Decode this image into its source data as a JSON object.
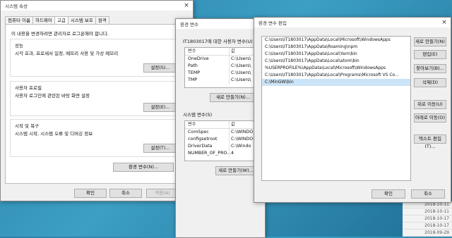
{
  "system_properties": {
    "title": "시스템 속성",
    "close_icon": "×",
    "tabs": [
      "컴퓨터 이름",
      "하드웨어",
      "고급",
      "시스템 보호",
      "원격"
    ],
    "admin_note": "이 내용을 변경하려면 관리자로 로그온해야 합니다.",
    "groups": [
      {
        "title": "성능",
        "desc": "시각 효과, 프로세서 일정, 메모리 사용 및 가상 메모리",
        "button": "설정(S)..."
      },
      {
        "title": "사용자 프로필",
        "desc": "사용자 로그인에 관련된 바탕 화면 설정",
        "button": "설정(E)..."
      },
      {
        "title": "시작 및 복구",
        "desc": "시스템 시작, 시스템 오류 및 디버깅 정보",
        "button": "설정(T)..."
      }
    ],
    "env_button": "환경 변수(N)...",
    "ok": "확인",
    "cancel": "취소",
    "apply": "적용(A)"
  },
  "env_vars": {
    "title": "환경 변수",
    "user_section": "IT1803017에 대한 사용자 변수(U)",
    "col_var": "변수",
    "col_val": "값",
    "user_vars": [
      {
        "name": "OneDrive",
        "value": "C:\\Users\\"
      },
      {
        "name": "Path",
        "value": "C:\\Users\\"
      },
      {
        "name": "TEMP",
        "value": "C:\\Users\\"
      },
      {
        "name": "TMP",
        "value": "C:\\Users\\"
      }
    ],
    "user_new": "새로 만들기(N)...",
    "system_section": "시스템 변수(S)",
    "system_vars": [
      {
        "name": "ComSpec",
        "value": "C:\\WINDO"
      },
      {
        "name": "configsetroot",
        "value": "C:\\WINDO"
      },
      {
        "name": "DriverData",
        "value": "C:\\Windo"
      },
      {
        "name": "NUMBER_OF_PRO...",
        "value": "4"
      }
    ],
    "system_new": "새로 만들기(W)..."
  },
  "edit_env": {
    "title": "환경 변수 편집",
    "close_icon": "×",
    "paths": [
      "C:\\Users\\IT1803017\\AppData\\Local\\Microsoft\\WindowsApps",
      "C:\\Users\\IT1803017\\AppData\\Roaming\\npm",
      "C:\\Users\\IT1803017\\AppData\\Local\\Yarn\\bin",
      "C:\\Users\\IT1803017\\AppData\\Local\\atom\\bin",
      "%USERPROFILE%\\AppData\\Local\\Microsoft\\WindowsApps",
      "C:\\Users\\IT1803017\\AppData\\Local\\Programs\\Microsoft VS Co...",
      "C:\\MinGW\\bin"
    ],
    "buttons": [
      "새로 만들기(N)",
      "편집(E)",
      "찾아보기(B)...",
      "삭제(D)",
      "위로 이동(U)",
      "아래로 이동(O)",
      "텍스트 편집(T)..."
    ],
    "ok": "확인",
    "cancel": "취소"
  },
  "background_dates": [
    "2018-10-11",
    "2018-10-11",
    "2018-10-17",
    "2018-10-17",
    "2018-09-29"
  ]
}
